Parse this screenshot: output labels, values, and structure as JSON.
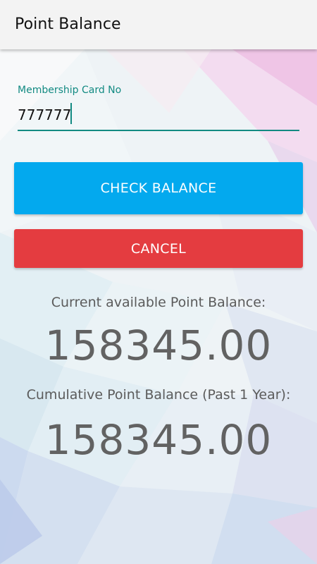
{
  "app_bar": {
    "title": "Point Balance"
  },
  "form": {
    "membership_label": "Membership Card No",
    "membership_value": "777777"
  },
  "buttons": {
    "check_balance": "CHECK BALANCE",
    "cancel": "CANCEL"
  },
  "balances": {
    "current_label": "Current available Point Balance:",
    "current_value": "158345.00",
    "cumulative_label": "Cumulative Point Balance (Past 1 Year):",
    "cumulative_value": "158345.00"
  },
  "colors": {
    "accent_teal": "#128a82",
    "check_button": "#03a9ee",
    "cancel_button": "#e43c40",
    "app_bar": "#f3f3f3"
  }
}
